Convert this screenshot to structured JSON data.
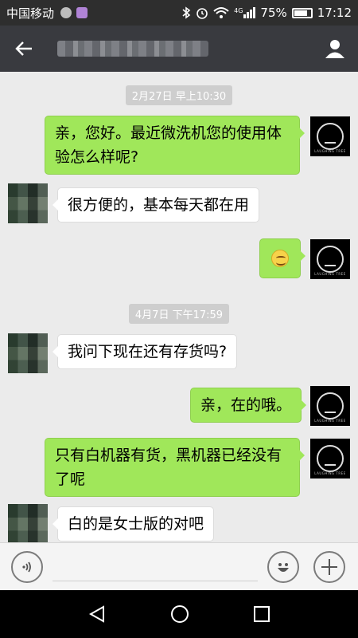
{
  "status_bar": {
    "carrier": "中国移动",
    "network_badge": "4G",
    "battery_text": "75%",
    "time": "17:12",
    "icons": [
      "chat-notification-icon",
      "gallery-notification-icon",
      "bluetooth-icon",
      "alarm-icon",
      "wifi-icon",
      "signal-icon",
      "battery-icon"
    ]
  },
  "header": {
    "back_icon": "back-arrow-icon",
    "contact_icon": "person-icon"
  },
  "timestamps": [
    "2月27日 早上10:30",
    "4月7日 下午17:59"
  ],
  "messages": [
    {
      "from": "me",
      "text": "亲，您好。最近微洗机您的使用体验怎么样呢?"
    },
    {
      "from": "them",
      "text": "很方便的，基本每天都在用"
    },
    {
      "from": "me",
      "emoji": "smile-emoji"
    },
    {
      "from": "them",
      "text": "我问下现在还有存货吗?"
    },
    {
      "from": "me",
      "text": "亲，在的哦。"
    },
    {
      "from": "me",
      "text": "只有白机器有货，黑机器已经没有了呢"
    },
    {
      "from": "them",
      "text": "白的是女士版的对吧"
    }
  ],
  "avatar_logo_text": "LAUGHING TREE",
  "input_bar": {
    "voice_icon": "voice-icon",
    "emoji_icon": "emoji-icon",
    "more_icon": "plus-icon",
    "value": ""
  },
  "nav_bar": {
    "icons": [
      "back-triangle-icon",
      "home-circle-icon",
      "recents-square-icon"
    ]
  }
}
